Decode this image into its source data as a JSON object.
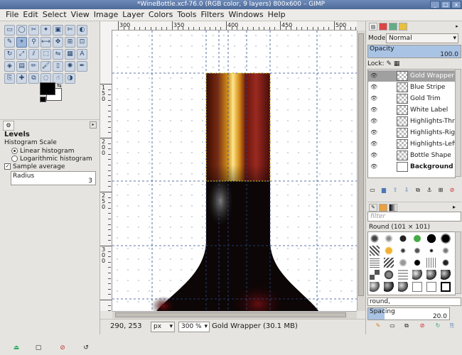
{
  "window": {
    "title": "*WineBottle.xcf-76.0 (RGB color, 9 layers) 800x600 – GIMP",
    "controls": [
      "_",
      "□",
      "x"
    ]
  },
  "menubar": [
    "File",
    "Edit",
    "Select",
    "View",
    "Image",
    "Layer",
    "Colors",
    "Tools",
    "Filters",
    "Windows",
    "Help"
  ],
  "toolbox": {
    "tools": [
      "rect-select",
      "ellipse-select",
      "free-select",
      "fuzzy-select",
      "color-select",
      "scissors",
      "foreground-select",
      "paths",
      "color-picker",
      "zoom",
      "measure",
      "move",
      "align",
      "crop",
      "rotate",
      "scale",
      "shear",
      "perspective",
      "flip",
      "cage",
      "text",
      "bucket-fill",
      "blend",
      "pencil",
      "paintbrush",
      "eraser",
      "airbrush",
      "ink",
      "clone",
      "heal",
      "perspective-clone",
      "blur",
      "smudge",
      "dodge-burn"
    ],
    "colors_fg": "#000000",
    "colors_bg": "#ffffff"
  },
  "tool_options": {
    "title": "Levels",
    "histogram_scale_label": "Histogram Scale",
    "options": [
      "Linear histogram",
      "Logarithmic histogram"
    ],
    "selected_option": "Linear histogram",
    "sample_average_label": "Sample average",
    "radius_label": "Radius",
    "radius_value": "3"
  },
  "rulers": {
    "h_labels": [
      "300",
      "350",
      "400",
      "450",
      "500"
    ],
    "v_labels": [
      "150",
      "200",
      "250",
      "300"
    ]
  },
  "status": {
    "coords": "290, 253",
    "unit": "px",
    "zoom": "300 %",
    "layer_info": "Gold Wrapper (30.1 MB)"
  },
  "layers_panel": {
    "mode_label": "Mode:",
    "mode_value": "Normal",
    "opacity_label": "Opacity",
    "opacity_value": "100.0",
    "lock_label": "Lock:",
    "layers": [
      {
        "name": "Gold Wrapper",
        "selected": true
      },
      {
        "name": "Blue Stripe",
        "selected": false
      },
      {
        "name": "Gold Trim",
        "selected": false
      },
      {
        "name": "White Label",
        "selected": false
      },
      {
        "name": "Highlights-Throat",
        "selected": false
      },
      {
        "name": "Highlights-Right In",
        "selected": false
      },
      {
        "name": "Highlights-Left Bo",
        "selected": false
      },
      {
        "name": "Bottle Shape",
        "selected": false
      },
      {
        "name": "Background",
        "selected": false
      }
    ]
  },
  "brushes_panel": {
    "filter_placeholder": "filter",
    "brush_name": "Round (101 × 101)",
    "tag_value": "round,",
    "spacing_label": "Spacing",
    "spacing_value": "20.0"
  }
}
